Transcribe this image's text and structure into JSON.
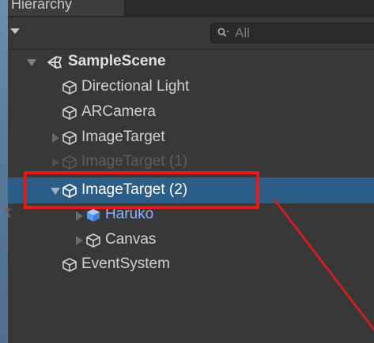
{
  "panel": {
    "tab_title": "Hierarchy"
  },
  "search": {
    "placeholder": "All"
  },
  "tree": {
    "scene_name": "SampleScene",
    "items": [
      {
        "label": "Directional Light"
      },
      {
        "label": "ARCamera"
      },
      {
        "label": "ImageTarget"
      },
      {
        "label": "ImageTarget (1)"
      },
      {
        "label": "ImageTarget (2)"
      },
      {
        "label": "Haruko"
      },
      {
        "label": "Canvas"
      },
      {
        "label": "EventSystem"
      }
    ]
  },
  "colors": {
    "selection": "#2c5d87",
    "annotation": "#e51a1a",
    "prefab_icon": "#6fa8ff"
  },
  "icons": [
    "unity-logo-icon",
    "search-icon",
    "gameobject-cube-icon",
    "prefab-cube-icon",
    "dropdown-caret-icon",
    "foldout-arrow-icon"
  ]
}
